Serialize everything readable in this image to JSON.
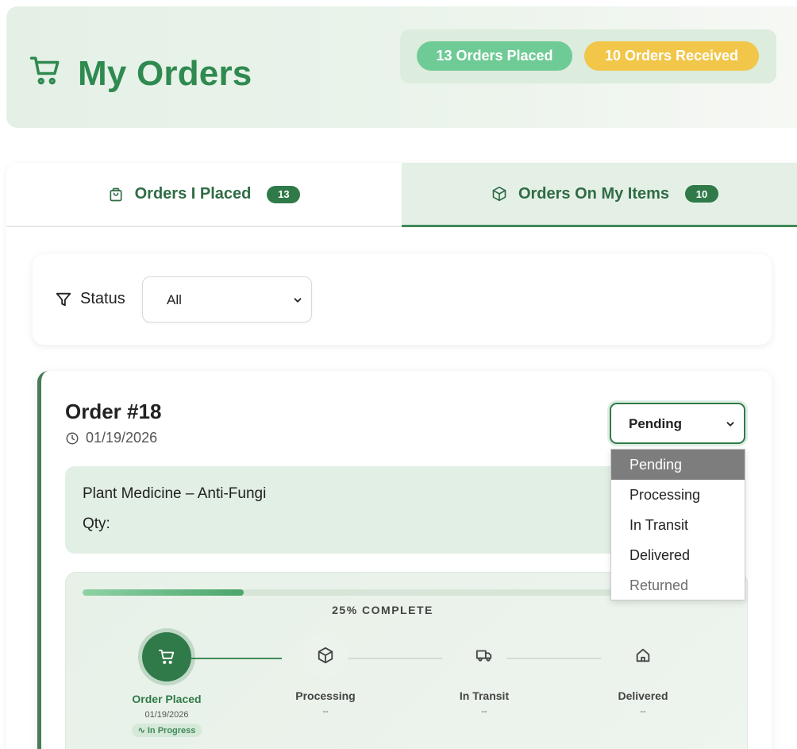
{
  "header": {
    "title": "My Orders",
    "icon": "shopping-cart-icon",
    "placed_badge": "13 Orders Placed",
    "received_badge": "10 Orders Received"
  },
  "tabs": [
    {
      "label": "Orders I Placed",
      "count": "13",
      "icon": "shopping-bag-icon",
      "active": false
    },
    {
      "label": "Orders On My Items",
      "count": "10",
      "icon": "package-icon",
      "active": true
    }
  ],
  "filter": {
    "label": "Status",
    "selected": "All",
    "icon": "filter-icon"
  },
  "order": {
    "title": "Order #18",
    "date": "01/19/2026",
    "status_selected": "Pending",
    "status_options": [
      "Pending",
      "Processing",
      "In Transit",
      "Delivered",
      "Returned"
    ],
    "product_name": "Plant Medicine – Anti-Fungi",
    "qty_label": "Qty:",
    "progress_percent": 25,
    "progress_label": "25% COMPLETE",
    "steps": [
      {
        "label": "Order Placed",
        "date": "01/19/2026",
        "badge": "In Progress",
        "icon": "shopping-cart-icon",
        "active": true
      },
      {
        "label": "Processing",
        "date": "--",
        "icon": "package-icon",
        "active": false
      },
      {
        "label": "In Transit",
        "date": "--",
        "icon": "truck-icon",
        "active": false
      },
      {
        "label": "Delivered",
        "date": "--",
        "icon": "home-icon",
        "active": false
      }
    ]
  },
  "colors": {
    "brand_green": "#2f8a50",
    "dark_green": "#2f7a48",
    "badge_green": "#6fcb95",
    "badge_yellow": "#f2c649"
  }
}
